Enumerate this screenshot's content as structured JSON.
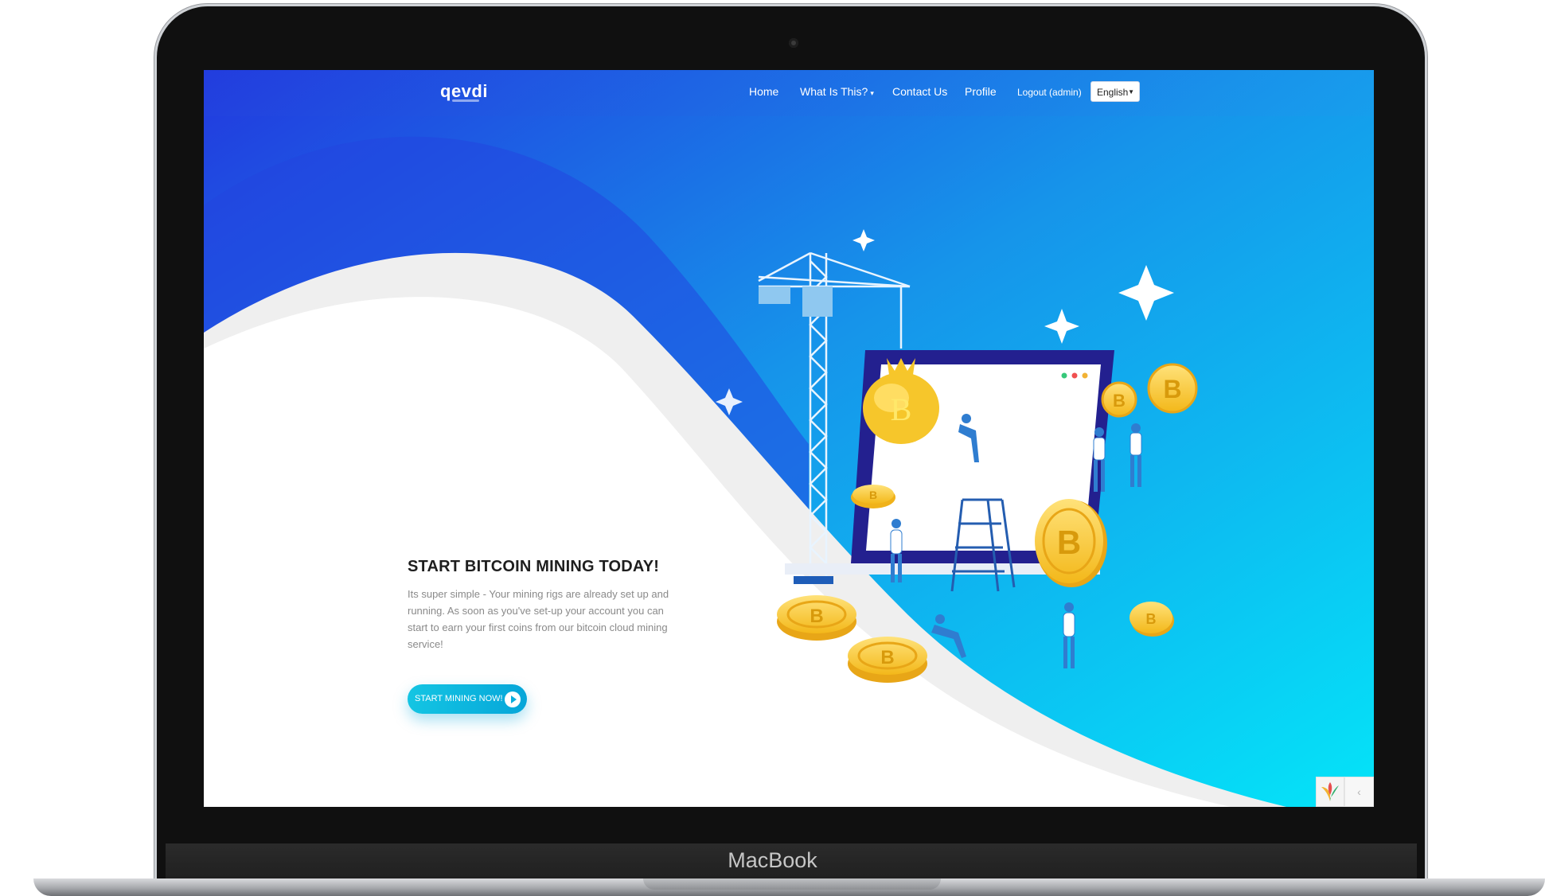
{
  "device": {
    "brand": "MacBook"
  },
  "nav": {
    "logo": "qevdi",
    "items": [
      {
        "label": "Home"
      },
      {
        "label": "What Is This?",
        "dropdown": true
      },
      {
        "label": "Contact Us"
      },
      {
        "label": "Profile"
      },
      {
        "label": "Logout (admin)"
      }
    ],
    "language": {
      "selected": "English"
    }
  },
  "hero": {
    "title": "START BITCOIN MINING TODAY!",
    "description": "Its super simple - Your mining rigs are already set up and running. As soon as you've set-up your account you can start to earn your first coins from our bitcoin cloud mining service!",
    "cta_label": "START MINING NOW!"
  },
  "colors": {
    "gradient_start": "#2340e0",
    "gradient_end": "#06e2f7",
    "coin_gold": "#f6c62b",
    "cta": "#0fb9e0"
  },
  "icons": [
    "crane",
    "bag-of-coins",
    "laptop",
    "bitcoin-coin",
    "sparkle",
    "play-icon",
    "chevron-left-icon"
  ]
}
